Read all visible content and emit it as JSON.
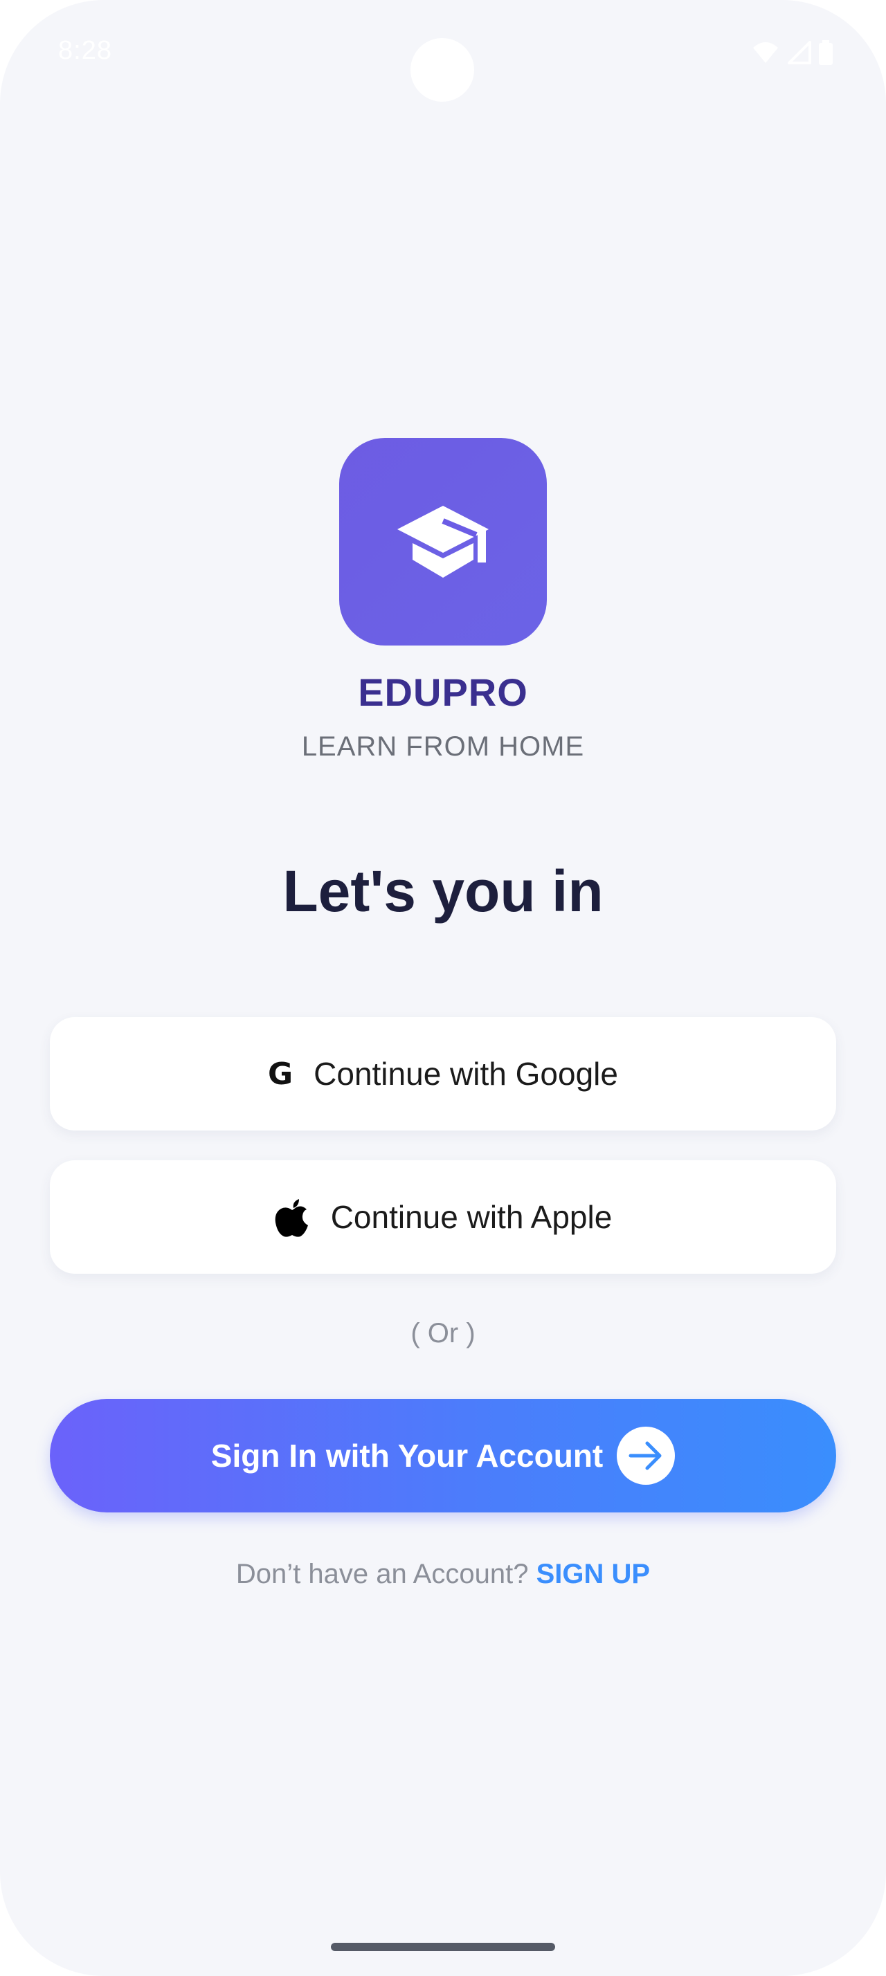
{
  "status_bar": {
    "time": "8:28",
    "icons": [
      "wifi-icon",
      "signal-icon",
      "battery-icon"
    ]
  },
  "brand": {
    "logo_icon": "graduation-cap-icon",
    "name": "EDUPRO",
    "tagline": "LEARN FROM HOME"
  },
  "heading": "Let's you in",
  "buttons": {
    "google": {
      "label": "Continue with Google",
      "icon": "google-icon",
      "icon_glyph": "G"
    },
    "apple": {
      "label": "Continue with Apple",
      "icon": "apple-icon"
    },
    "divider": "( Or )",
    "signin": {
      "label": "Sign In with Your Account",
      "icon": "arrow-right-icon"
    }
  },
  "signup": {
    "prompt": "Don’t have an Account?",
    "link": "SIGN UP"
  },
  "colors": {
    "background": "#f5f6fa",
    "logo": "#6b5ce5",
    "brand_text": "#3a2f8f",
    "heading_text": "#1d1f3d",
    "gradient_start": "#6b62fa",
    "gradient_end": "#3a8efd",
    "link": "#3a8efd"
  }
}
